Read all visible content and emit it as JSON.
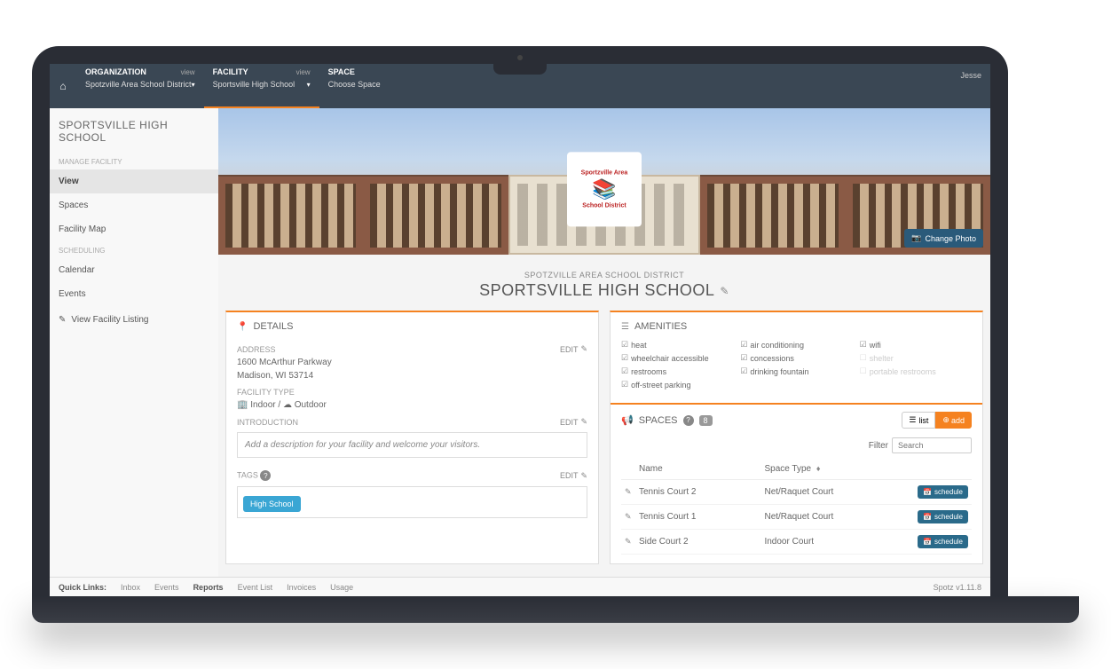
{
  "topbar": {
    "home_icon": "⌂",
    "user": "Jesse",
    "sections": [
      {
        "label": "ORGANIZATION",
        "value": "Spotzville Area School District",
        "view": "view",
        "has_dropdown": true
      },
      {
        "label": "FACILITY",
        "value": "Sportsville High School",
        "view": "view",
        "has_dropdown": true,
        "active": true
      },
      {
        "label": "SPACE",
        "value": "Choose Space",
        "view": "",
        "has_dropdown": false
      }
    ]
  },
  "sidebar": {
    "title": "SPORTSVILLE HIGH SCHOOL",
    "groups": [
      {
        "label": "MANAGE FACILITY",
        "items": [
          {
            "label": "View",
            "active": true
          },
          {
            "label": "Spaces"
          },
          {
            "label": "Facility Map"
          }
        ]
      },
      {
        "label": "SCHEDULING",
        "items": [
          {
            "label": "Calendar"
          },
          {
            "label": "Events"
          }
        ]
      }
    ],
    "external_link": {
      "icon": "✎",
      "label": "View Facility Listing"
    }
  },
  "hero": {
    "logo_top": "Sportzville Area",
    "logo_bottom": "School District",
    "change_photo": "Change Photo",
    "camera_icon": "📷"
  },
  "heading": {
    "org": "SPOTZVILLE AREA SCHOOL DISTRICT",
    "facility": "SPORTSVILLE HIGH SCHOOL",
    "edit_icon": "✎"
  },
  "details": {
    "title": "DETAILS",
    "icon": "📍",
    "address_label": "ADDRESS",
    "address_line1": "1600 McArthur Parkway",
    "address_line2": "Madison, WI 53714",
    "facility_type_label": "FACILITY TYPE",
    "type_indoor_icon": "🏢",
    "type_indoor": "Indoor",
    "type_sep": "/",
    "type_outdoor_icon": "☁",
    "type_outdoor": "Outdoor",
    "introduction_label": "INTRODUCTION",
    "introduction_placeholder": "Add a description for your facility and welcome your visitors.",
    "tags_label": "TAGS",
    "tags": [
      "High School"
    ],
    "edit_label": "EDIT",
    "help_icon": "?"
  },
  "amenities": {
    "title": "AMENITIES",
    "icon": "☰",
    "items": [
      {
        "label": "heat",
        "checked": true
      },
      {
        "label": "air conditioning",
        "checked": true
      },
      {
        "label": "wifi",
        "checked": true
      },
      {
        "label": "wheelchair accessible",
        "checked": true
      },
      {
        "label": "concessions",
        "checked": true
      },
      {
        "label": "shelter",
        "checked": false
      },
      {
        "label": "restrooms",
        "checked": true
      },
      {
        "label": "drinking fountain",
        "checked": true
      },
      {
        "label": "portable restrooms",
        "checked": false
      },
      {
        "label": "off-street parking",
        "checked": true
      }
    ]
  },
  "spaces": {
    "title": "SPACES",
    "icon": "📢",
    "count": "8",
    "help_icon": "?",
    "list_btn": "list",
    "list_icon": "☰",
    "add_btn": "add",
    "add_icon": "⊕",
    "filter_label": "Filter",
    "filter_placeholder": "Search",
    "columns": {
      "name": "Name",
      "type": "Space Type",
      "sort_icon": "♦"
    },
    "rows": [
      {
        "name": "Tennis Court 2",
        "type": "Net/Raquet Court",
        "schedule": "schedule"
      },
      {
        "name": "Tennis Court 1",
        "type": "Net/Raquet Court",
        "schedule": "schedule"
      },
      {
        "name": "Side Court 2",
        "type": "Indoor Court",
        "schedule": "schedule"
      }
    ],
    "row_icon": "✎",
    "cal_icon": "📅"
  },
  "footer": {
    "label": "Quick Links:",
    "links": [
      "Inbox",
      "Events",
      "Reports",
      "Event List",
      "Invoices",
      "Usage"
    ],
    "bold_index": 2,
    "version": "Spotz v1.11.8"
  }
}
